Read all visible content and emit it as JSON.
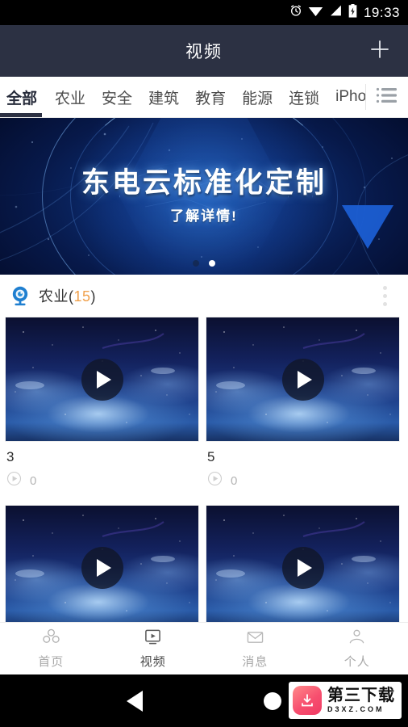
{
  "statusbar": {
    "time": "19:33",
    "icons": [
      "alarm-icon",
      "wifi-icon",
      "signal-icon",
      "battery-charging-icon"
    ]
  },
  "appbar": {
    "title": "视频",
    "add_icon": "plus-icon"
  },
  "tabs": {
    "items": [
      {
        "label": "全部",
        "active": true
      },
      {
        "label": "农业",
        "active": false
      },
      {
        "label": "安全",
        "active": false
      },
      {
        "label": "建筑",
        "active": false
      },
      {
        "label": "教育",
        "active": false
      },
      {
        "label": "能源",
        "active": false
      },
      {
        "label": "连锁",
        "active": false
      },
      {
        "label": "iPhone",
        "active": false
      }
    ],
    "menu_icon": "list-menu-icon"
  },
  "banner": {
    "title": "东电云标准化定制",
    "subtitle": "了解详情!",
    "dots": [
      {
        "active": false
      },
      {
        "active": true
      }
    ]
  },
  "section": {
    "icon": "webcam-icon",
    "name": "农业",
    "open_paren": "(",
    "count": "15",
    "close_paren": ")",
    "more_icon": "more-vertical-icon"
  },
  "videos": [
    {
      "title": "3",
      "plays": "0",
      "play_icon": "play-circle-icon",
      "overlay_icon": "play-button-icon"
    },
    {
      "title": "5",
      "plays": "0",
      "play_icon": "play-circle-icon",
      "overlay_icon": "play-button-icon"
    },
    {
      "title": "",
      "plays": "",
      "play_icon": "play-circle-icon",
      "overlay_icon": "play-button-icon"
    },
    {
      "title": "",
      "plays": "",
      "play_icon": "play-circle-icon",
      "overlay_icon": "play-button-icon"
    }
  ],
  "bottomnav": {
    "items": [
      {
        "label": "首页",
        "icon": "home-cubes-icon",
        "active": false
      },
      {
        "label": "视频",
        "icon": "video-screen-icon",
        "active": true
      },
      {
        "label": "消息",
        "icon": "envelope-icon",
        "active": false
      },
      {
        "label": "个人",
        "icon": "person-icon",
        "active": false
      }
    ]
  },
  "androidnav": {
    "back_icon": "back-triangle-icon",
    "home_icon": "home-circle-icon"
  },
  "watermark": {
    "logo_icon": "download-arrow-icon",
    "cn": "第三下载",
    "en": "D3XZ.COM"
  },
  "colors": {
    "appbar": "#2c3143",
    "accent_count": "#f0a04b",
    "banner_blue": "#1c5fd6",
    "watermark_red": "#f03a64"
  }
}
